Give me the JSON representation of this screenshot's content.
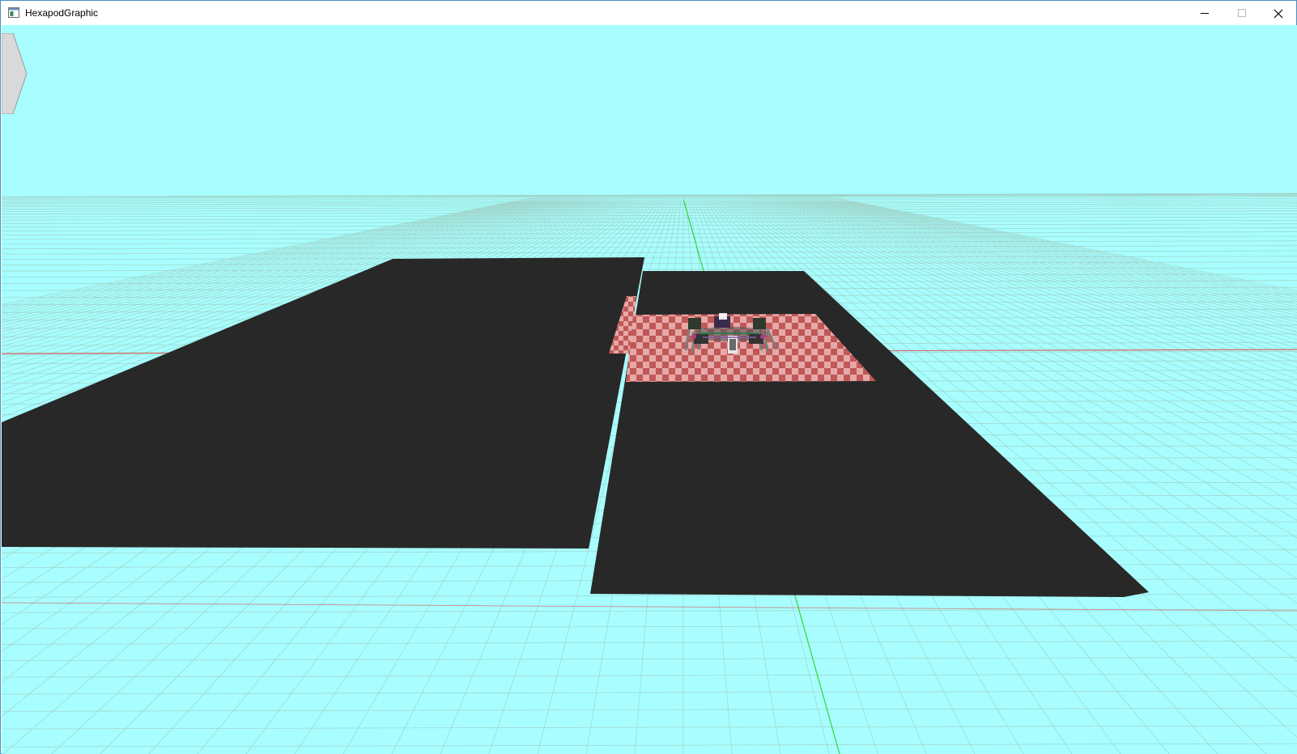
{
  "window": {
    "title": "HexapodGraphic",
    "icon": "app-window-icon",
    "controls": {
      "minimize_icon": "minimize-icon",
      "maximize_icon": "maximize-icon",
      "close_icon": "close-icon"
    }
  },
  "scene": {
    "background_color": "#a8fefe",
    "grid_color": "#9fd2c8",
    "axis_green_color": "#33d633",
    "axis_red_color": "#d46a6a",
    "platform_color": "#282828",
    "checker_colors": [
      "#c05858",
      "#e7a8a8"
    ],
    "robot": "hexapod-robot",
    "side_panel_toggle_icon": "chevron-right-icon"
  }
}
